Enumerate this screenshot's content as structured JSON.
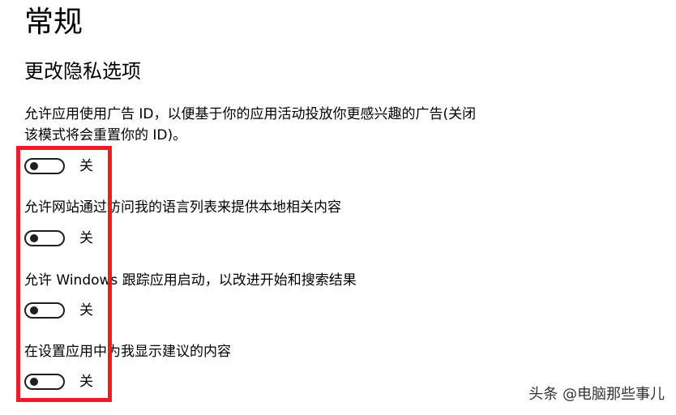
{
  "page": {
    "title": "常规",
    "section_title": "更改隐私选项"
  },
  "settings": [
    {
      "description": "允许应用使用广告 ID，以便基于你的应用活动投放你更感兴趣的广告(关闭该模式将会重置你的 ID)。",
      "state_label": "关",
      "enabled": false
    },
    {
      "description": "允许网站通过访问我的语言列表来提供本地相关内容",
      "state_label": "关",
      "enabled": false
    },
    {
      "description": "允许 Windows 跟踪应用启动，以改进开始和搜索结果",
      "state_label": "关",
      "enabled": false
    },
    {
      "description": "在设置应用中为我显示建议的内容",
      "state_label": "关",
      "enabled": false
    }
  ],
  "annotation": {
    "highlight_color": "#ee1c25"
  },
  "watermark": {
    "text": "头条 @电脑那些事儿"
  }
}
